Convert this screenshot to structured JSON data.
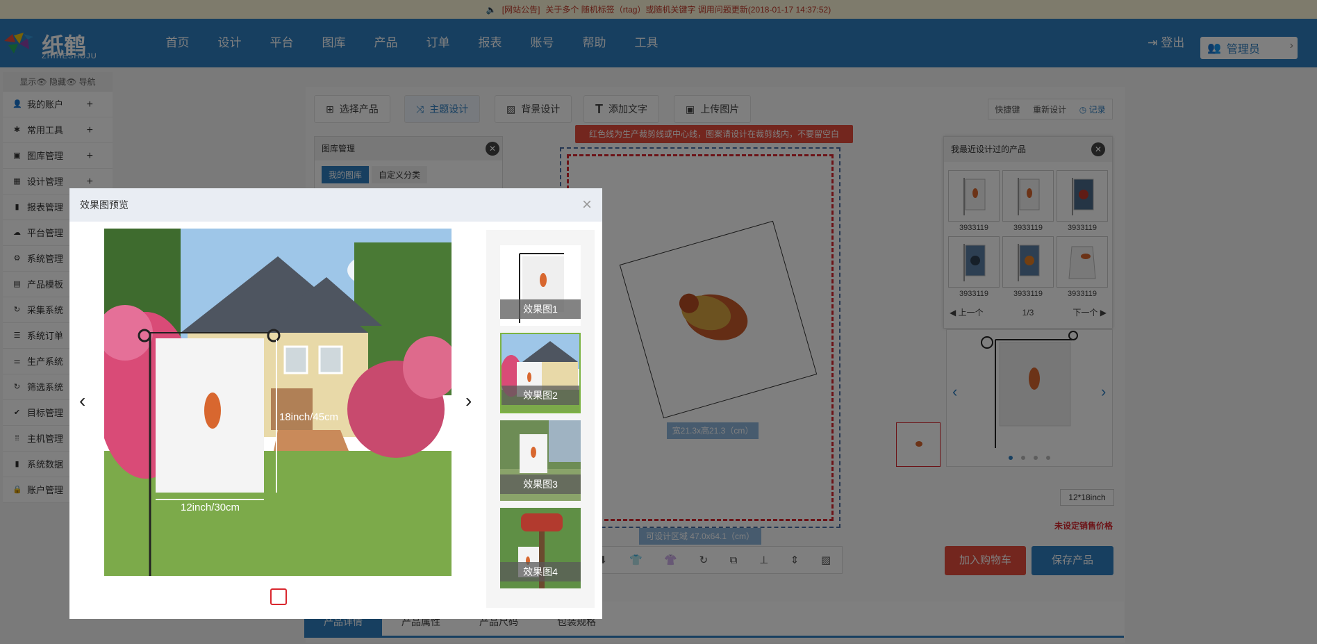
{
  "notice": {
    "prefix": "[网站公告]",
    "text": "关于多个 随机标签（rtag）或随机关键字 调用问题更新(2018-01-17 14:37:52)"
  },
  "header": {
    "logo_cn": "纸鹤",
    "logo_en": "ZHIHESHUJU",
    "nav": [
      "首页",
      "设计",
      "平台",
      "图库",
      "产品",
      "订单",
      "报表",
      "账号",
      "帮助",
      "工具"
    ],
    "logout": "登出",
    "admin": "管理员"
  },
  "sidebar": {
    "toggle": "显示👁 隐藏👁 导航",
    "items": [
      {
        "label": "我的账户",
        "icon": "user-icon",
        "plus": "+"
      },
      {
        "label": "常用工具",
        "icon": "gear-icon",
        "plus": "+"
      },
      {
        "label": "图库管理",
        "icon": "image-icon",
        "plus": "+"
      },
      {
        "label": "设计管理",
        "icon": "grid-icon",
        "plus": "+"
      },
      {
        "label": "报表管理",
        "icon": "bar-chart-icon"
      },
      {
        "label": "平台管理",
        "icon": "cloud-icon"
      },
      {
        "label": "系统管理",
        "icon": "cog-icon"
      },
      {
        "label": "产品模板",
        "icon": "file-icon"
      },
      {
        "label": "采集系统",
        "icon": "refresh-icon"
      },
      {
        "label": "系统订单",
        "icon": "list-icon"
      },
      {
        "label": "生产系统",
        "icon": "sliders-icon"
      },
      {
        "label": "筛选系统",
        "icon": "refresh-icon"
      },
      {
        "label": "目标管理",
        "icon": "check-icon"
      },
      {
        "label": "主机管理",
        "icon": "th-icon"
      },
      {
        "label": "系统数据",
        "icon": "bar-chart-icon"
      },
      {
        "label": "账户管理",
        "icon": "lock-icon"
      }
    ]
  },
  "toolbar": {
    "tabs": [
      "选择产品",
      "主题设计",
      "背景设计",
      "添加文字",
      "上传图片"
    ],
    "active": 1,
    "right": {
      "shortcut": "快捷键",
      "redesign": "重新设计",
      "record": "记录"
    }
  },
  "canvas": {
    "hint": "红色线为生产裁剪线或中心线，图案请设计在裁剪线内，不要留空白",
    "size_label": "宽21.3x高21.3（cm）",
    "area_label": "可设计区域 47.0x64.1（cm）"
  },
  "gallery": {
    "title": "图库管理",
    "tabs": [
      "我的图库",
      "自定义分类"
    ]
  },
  "recent": {
    "title": "我最近设计过的产品",
    "items": [
      "3933119",
      "3933119",
      "3933119",
      "3933119",
      "3933119",
      "3933119"
    ],
    "prev": "上一个",
    "page": "1/3",
    "next": "下一个"
  },
  "product": {
    "size": "12*18inch",
    "no_price": "未设定销售价格",
    "add_cart": "加入购物车",
    "save": "保存产品"
  },
  "detail_tabs": [
    "产品详情",
    "产品属性",
    "产品尺码",
    "包装规格"
  ],
  "modal": {
    "title": "效果图预览",
    "close": "×",
    "height_label": "18inch/45cm",
    "width_label": "12inch/30cm",
    "thumbs": [
      "效果图1",
      "效果图2",
      "效果图3",
      "效果图4"
    ],
    "selected": 1
  },
  "colors": {
    "brand": "#2f7fc1",
    "danger": "#e74c3c",
    "notice_text": "#c0392b",
    "select_border": "#7cb342"
  }
}
